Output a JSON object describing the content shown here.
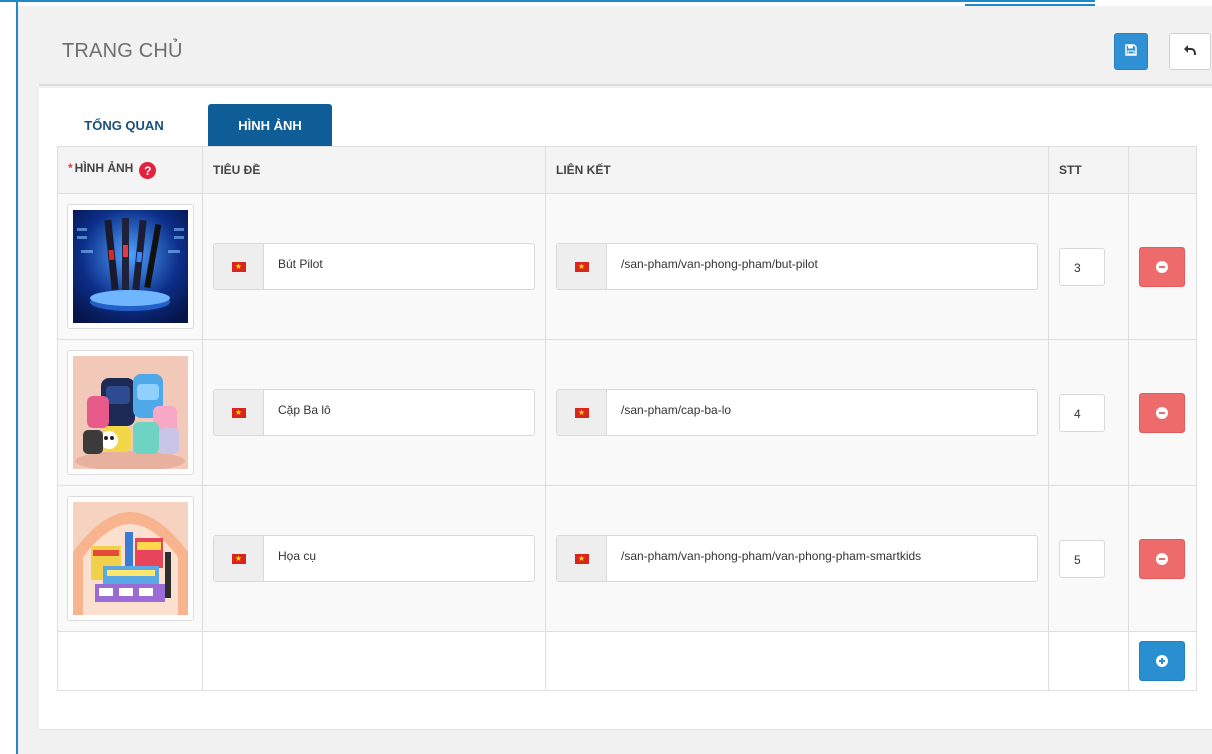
{
  "page": {
    "title": "TRANG CHỦ"
  },
  "toolbar": {
    "save_icon": "save-icon",
    "back_icon": "undo-arrow-icon"
  },
  "tabs": [
    {
      "label": "TỔNG QUAN",
      "active": false
    },
    {
      "label": "HÌNH ẢNH",
      "active": true
    }
  ],
  "table": {
    "required_mark": "*",
    "columns": {
      "image": "HÌNH ẢNH",
      "title": "TIÊU ĐỀ",
      "link": "LIÊN KẾT",
      "order": "STT"
    },
    "help_icon_glyph": "?",
    "rows": [
      {
        "image_icon": "pens-product-image",
        "title": "Bút Pilot",
        "link": "/san-pham/van-phong-pham/but-pilot",
        "order": "3"
      },
      {
        "image_icon": "backpack-product-image",
        "title": "Cặp Ba lô",
        "link": "/san-pham/cap-ba-lo",
        "order": "4"
      },
      {
        "image_icon": "art-supplies-product-image",
        "title": "Họa cụ",
        "link": "/san-pham/van-phong-pham/van-phong-pham-smartkids",
        "order": "5"
      }
    ]
  },
  "colors": {
    "accent": "#1e88c8",
    "active_tab": "#0f5d96",
    "save_button": "#2f90d4",
    "remove_button": "#ee6b6b",
    "add_button": "#2a8fd1",
    "help_icon": "#e2223e"
  },
  "flag_icon": "vietnam-flag-icon"
}
